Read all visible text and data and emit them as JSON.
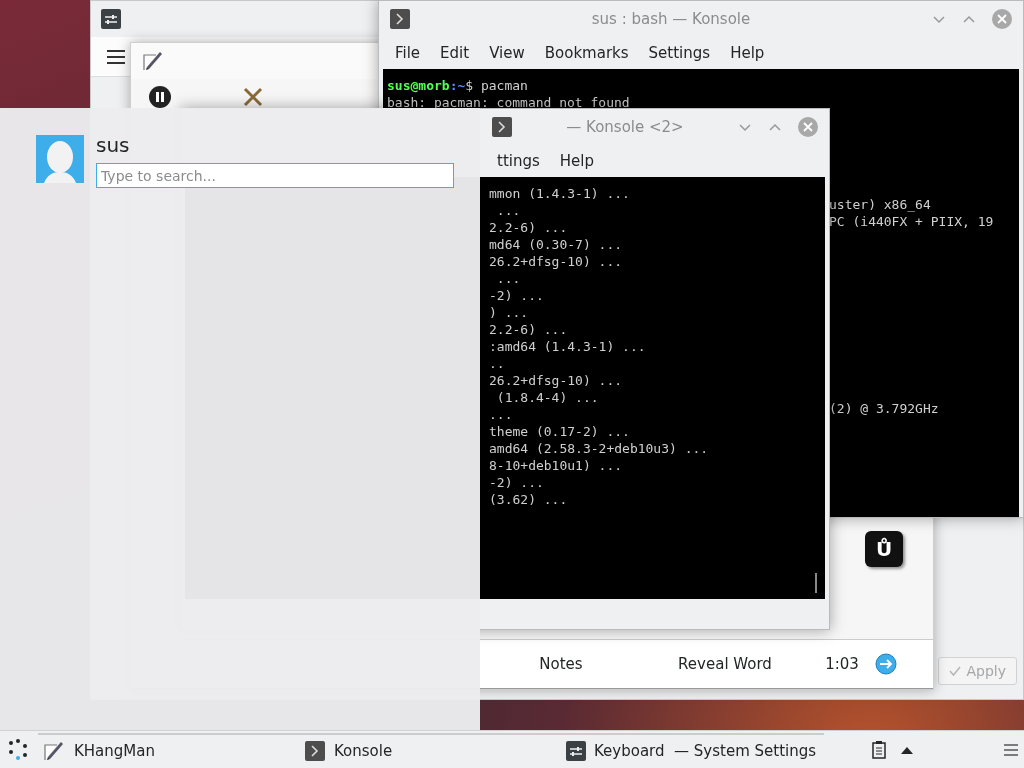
{
  "system_settings_window": {
    "apply_button": {
      "label": "Apply",
      "disabled": true
    }
  },
  "khangman_window": {
    "key": "Ů",
    "bottom_bar": [
      "Notes",
      "Reveal Word"
    ],
    "timer": "1:03"
  },
  "konsole_windows": [
    {
      "title": "sus : bash — Konsole",
      "menu": [
        "File",
        "Edit",
        "View",
        "Bookmarks",
        "Settings",
        "Help"
      ],
      "lines": [
        {
          "kind": "prompt",
          "user": "sus@morb",
          "path": ":~",
          "command": "$ pacman"
        },
        {
          "kind": "output",
          "text": "bash: pacman: command not found"
        }
      ],
      "side_lines": [
        "uster) x86_64",
        "PC (i440FX + PIIX, 19",
        "(2) @ 3.792GHz"
      ]
    },
    {
      "title": "— Konsole <2>",
      "menu": [
        "ttings",
        "Help"
      ],
      "lines": [
        {
          "kind": "output",
          "text": "mmon (1.4.3-1) ..."
        },
        {
          "kind": "output",
          "text": " ..."
        },
        {
          "kind": "output",
          "text": "2.2-6) ..."
        },
        {
          "kind": "output",
          "text": "md64 (0.30-7) ..."
        },
        {
          "kind": "output",
          "text": "26.2+dfsg-10) ..."
        },
        {
          "kind": "output",
          "text": " ..."
        },
        {
          "kind": "output",
          "text": "-2) ..."
        },
        {
          "kind": "output",
          "text": ") ..."
        },
        {
          "kind": "output",
          "text": "2.2-6) ..."
        },
        {
          "kind": "output",
          "text": ":amd64 (1.4.3-1) ..."
        },
        {
          "kind": "output",
          "text": ".."
        },
        {
          "kind": "output",
          "text": "26.2+dfsg-10) ..."
        },
        {
          "kind": "output",
          "text": " (1.8.4-4) ..."
        },
        {
          "kind": "output",
          "text": "..."
        },
        {
          "kind": "output",
          "text": "theme (0.17-2) ..."
        },
        {
          "kind": "output",
          "text": "amd64 (2.58.3-2+deb10u3) ..."
        },
        {
          "kind": "output",
          "text": "8-10+deb10u1) ..."
        },
        {
          "kind": "output",
          "text": "-2) ..."
        },
        {
          "kind": "output",
          "text": "(3.62) ..."
        }
      ]
    }
  ],
  "launcher": {
    "user_name": "sus",
    "search": {
      "placeholder": "Type to search..."
    }
  },
  "taskbar": {
    "tasks": [
      {
        "label": "KHangMan"
      },
      {
        "label": "Konsole"
      },
      {
        "label": "Keyboard  — System Settings"
      }
    ]
  }
}
